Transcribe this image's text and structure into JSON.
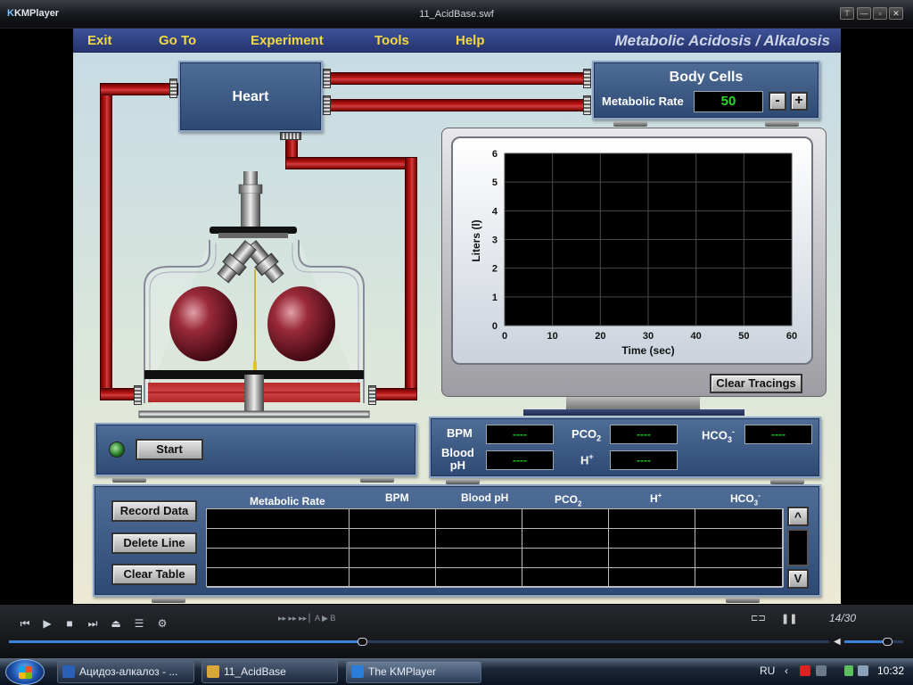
{
  "window": {
    "app_name": "KMPlayer",
    "title": "11_AcidBase.swf",
    "buttons": [
      "⊤",
      "—",
      "▫",
      "✕"
    ]
  },
  "menu": {
    "items": [
      "Exit",
      "Go To",
      "Experiment",
      "Tools",
      "Help"
    ],
    "sim_title": "Metabolic Acidosis / Alkalosis"
  },
  "heart": {
    "label": "Heart"
  },
  "body_cells": {
    "title": "Body Cells",
    "rate_label": "Metabolic Rate",
    "rate_value": "50",
    "minus": "-",
    "plus": "+"
  },
  "oscilloscope": {
    "clear_button": "Clear Tracings"
  },
  "chart_data": {
    "type": "line",
    "xlabel": "Time (sec)",
    "ylabel": "Liters (l)",
    "x_ticks": [
      "0",
      "10",
      "20",
      "30",
      "40",
      "50",
      "60"
    ],
    "y_ticks": [
      "0",
      "1",
      "2",
      "3",
      "4",
      "5",
      "6"
    ],
    "xlim": [
      0,
      60
    ],
    "ylim": [
      0,
      6
    ],
    "grid": true,
    "series": []
  },
  "start": {
    "label": "Start"
  },
  "readouts": {
    "bpm_label": "BPM",
    "bpm_value": "----",
    "pco2_label": "PCO",
    "pco2_sub": "2",
    "pco2_value": "----",
    "hco3_label": "HCO",
    "hco3_sub": "3",
    "hco3_sup": "-",
    "hco3_value": "----",
    "ph_label1": "Blood",
    "ph_label2": "pH",
    "ph_value": "----",
    "h_label": "H",
    "h_sup": "+",
    "h_value": "----"
  },
  "table": {
    "buttons": [
      "Record Data",
      "Delete Line",
      "Clear Table"
    ],
    "col_metabolic": "Metabolic Rate",
    "col_bpm": "BPM",
    "col_ph": "Blood pH",
    "col_pco2": "PCO",
    "col_pco2_sub": "2",
    "col_h": "H",
    "col_h_sup": "+",
    "col_hco3": "HCO",
    "col_hco3_sub": "3",
    "col_hco3_sup": "-",
    "rows": 4,
    "scroll_up": "^",
    "scroll_down": "V"
  },
  "player": {
    "controls": [
      "⏮",
      "▶",
      "■",
      "⏭",
      "⏏",
      "☰",
      "⚙"
    ],
    "ab_text": "A ▶ B",
    "time": "14/30",
    "progress": 0.43,
    "volume": 0.72
  },
  "taskbar": {
    "tasks": [
      "Ацидоз-алкалоз - ...",
      "11_AcidBase",
      "The KMPlayer"
    ],
    "language": "RU",
    "clock": "10:32"
  },
  "colors": {
    "menu_text": "#f2d843",
    "tube": "#c11b1b",
    "readout": "#18c818",
    "panel": "#3a5882"
  }
}
